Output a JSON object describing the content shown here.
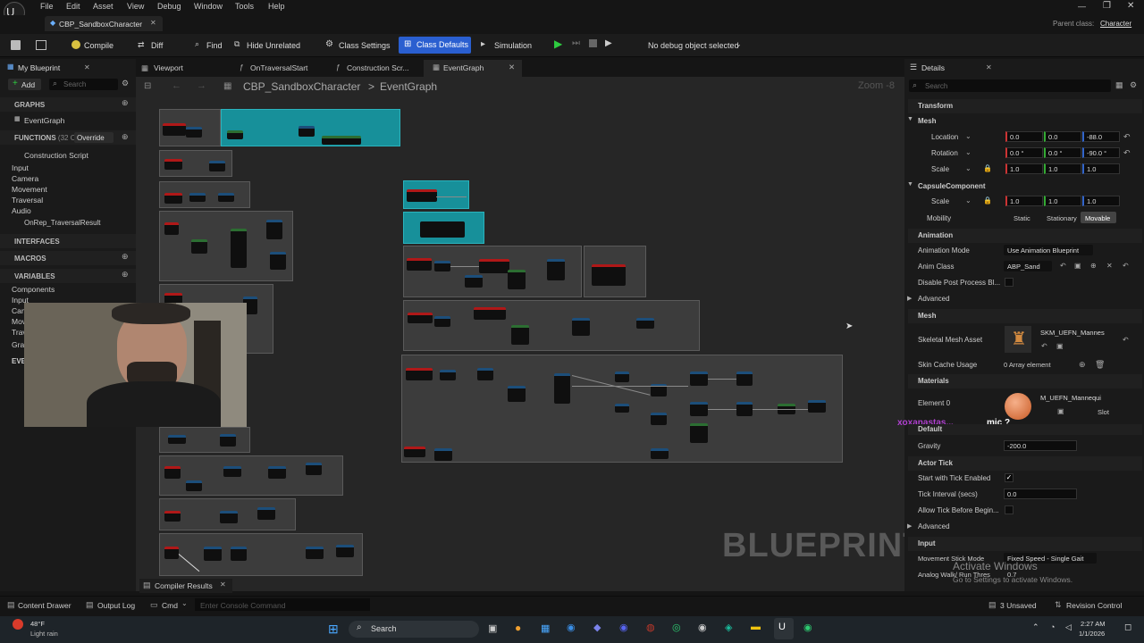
{
  "menu": [
    "File",
    "Edit",
    "Asset",
    "View",
    "Debug",
    "Window",
    "Tools",
    "Help"
  ],
  "window": {
    "tab_title": "CBP_SandboxCharacter",
    "parent_class_label": "Parent class:",
    "parent_class_value": "Character"
  },
  "toolbar": {
    "compile": "Compile",
    "diff": "Diff",
    "find": "Find",
    "hide_unrelated": "Hide Unrelated",
    "class_settings": "Class Settings",
    "class_defaults": "Class Defaults",
    "simulation": "Simulation",
    "debug_object": "No debug object selected"
  },
  "left_panel": {
    "tab": "My Blueprint",
    "add": "Add",
    "search_placeholder": "Search",
    "graphs": "GRAPHS",
    "event_graph": "EventGraph",
    "functions": "FUNCTIONS",
    "functions_count": "(32 O",
    "override": "Override",
    "function_items": [
      "Construction Script",
      "Input",
      "Camera",
      "Movement",
      "Traversal",
      "Audio",
      "OnRep_TraversalResult"
    ],
    "interfaces": "INTERFACES",
    "macros": "MACROS",
    "variables": "VARIABLES",
    "variable_items": [
      "Components",
      "Input",
      "Cam",
      "Mov",
      "Trav",
      "Gra"
    ],
    "event_dispatchers": "EVE"
  },
  "graph_tabs": [
    "Viewport",
    "OnTraversalStart",
    "Construction Scr...",
    "EventGraph"
  ],
  "breadcrumb": {
    "root": "CBP_SandboxCharacter",
    "sep": ">",
    "current": "EventGraph",
    "zoom": "Zoom -8"
  },
  "watermark": "BLUEPRINT",
  "details": {
    "tab": "Details",
    "search_placeholder": "Search",
    "transform": "Transform",
    "mesh": "Mesh",
    "location": "Location",
    "rotation": "Rotation",
    "scale": "Scale",
    "loc_vals": [
      "0.0",
      "0.0",
      "-88.0"
    ],
    "rot_vals": [
      "0.0 °",
      "0.0 °",
      "-90.0 °"
    ],
    "scale_vals": [
      "1.0",
      "1.0",
      "1.0"
    ],
    "capsule": "CapsuleComponent",
    "cap_scale_vals": [
      "1.0",
      "1.0",
      "1.0"
    ],
    "mobility": "Mobility",
    "mob_static": "Static",
    "mob_stationary": "Stationary",
    "mob_movable": "Movable",
    "animation": "Animation",
    "anim_mode": "Animation Mode",
    "anim_mode_val": "Use Animation Blueprint",
    "anim_class": "Anim Class",
    "anim_class_val": "ABP_Sand",
    "disable_pp": "Disable Post Process Bl...",
    "advanced": "Advanced",
    "mesh_section": "Mesh",
    "skeletal_mesh": "Skeletal Mesh Asset",
    "skeletal_mesh_val": "SKM_UEFN_Mannes",
    "skin_cache": "Skin Cache Usage",
    "skin_cache_val": "0 Array element",
    "materials": "Materials",
    "element0": "Element 0",
    "element0_val": "M_UEFN_Mannequi",
    "slot": "Slot",
    "default": "Default",
    "gravity": "Gravity",
    "gravity_val": "-200.0",
    "actor_tick": "Actor Tick",
    "start_tick": "Start with Tick Enabled",
    "tick_interval": "Tick Interval (secs)",
    "tick_interval_val": "0.0",
    "allow_tick": "Allow Tick Before Begin...",
    "advanced2": "Advanced",
    "input": "Input",
    "move_stick": "Movement Stick Mode",
    "move_stick_val": "Fixed Speed - Single Gait",
    "analog_walk": "Analog Walk/ Run Thres",
    "analog_walk_val": "0.7"
  },
  "overlay": {
    "chat_user": "xoxanastas...",
    "chat_msg": "mic ?",
    "activate_title": "Activate Windows",
    "activate_sub": "Go to Settings to activate Windows."
  },
  "statusbar": {
    "content_drawer": "Content Drawer",
    "output_log": "Output Log",
    "cmd": "Cmd",
    "console_placeholder": "Enter Console Command",
    "unsaved": "3 Unsaved",
    "revision": "Revision Control",
    "compiler_results": "Compiler Results"
  },
  "taskbar": {
    "weather_temp": "48°F",
    "weather_desc": "Light rain",
    "search": "Search",
    "time": "2:27 AM",
    "date": "1/1/2026"
  },
  "colors": {
    "accent": "#2a5fd0",
    "comment_teal": "#17909a",
    "node_red": "#b01818",
    "chat_user": "#b040d0"
  }
}
